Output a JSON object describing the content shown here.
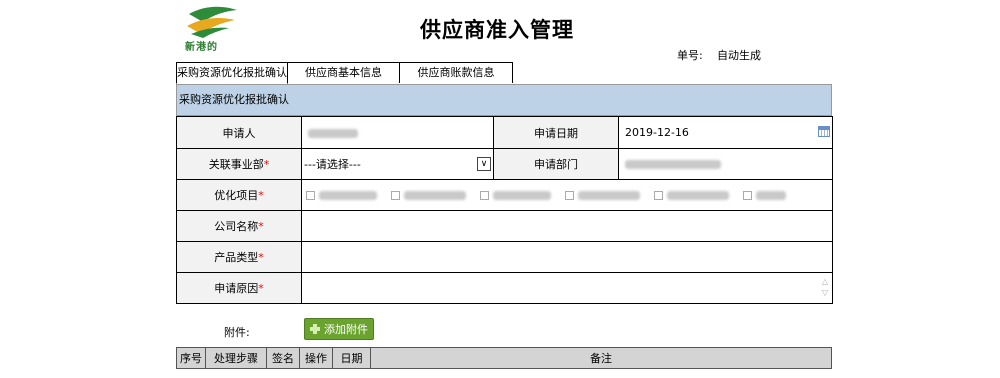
{
  "header": {
    "logo_icon": "company-logo",
    "logo_text": "新港的",
    "title": "供应商准入管理",
    "doc_no_label": "单号:",
    "doc_no_value": "自动生成"
  },
  "tabs": [
    {
      "label": "采购资源优化报批确认",
      "active": true
    },
    {
      "label": "供应商基本信息",
      "active": false
    },
    {
      "label": "供应商账款信息",
      "active": false
    }
  ],
  "section_title": "采购资源优化报批确认",
  "form": {
    "applicant_label": "申请人",
    "apply_date_label": "申请日期",
    "apply_date_value": "2019-12-16",
    "business_unit_label": "关联事业部",
    "business_unit_value": "---请选择---",
    "department_label": "申请部门",
    "optimize_items_label": "优化项目",
    "company_name_label": "公司名称",
    "product_type_label": "产品类型",
    "reason_label": "申请原因",
    "required_mark": "*"
  },
  "attachment": {
    "label": "附件:",
    "button_label": "添加附件"
  },
  "steps_table": {
    "headers": [
      "序号",
      "处理步骤",
      "签名",
      "操作",
      "日期",
      "备注"
    ]
  },
  "colors": {
    "section_bar": "#bdd2e6",
    "attach_button": "#6aa42e",
    "required": "#e00000"
  }
}
